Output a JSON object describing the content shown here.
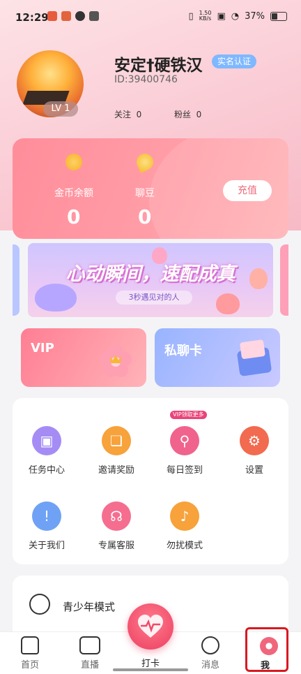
{
  "status_bar": {
    "time": "12:29",
    "net_speed_value": "1.50",
    "net_speed_unit": "KB/s",
    "battery": "37%"
  },
  "profile": {
    "nickname": "安定†硬铁汉",
    "verified_badge": "实名认证",
    "user_id": "ID:39400746",
    "level": "LV 1",
    "follow_label": "关注",
    "follow_count": "0",
    "fans_label": "粉丝",
    "fans_count": "0"
  },
  "wallet": {
    "coins_label": "金币余额",
    "coins_value": "0",
    "beans_label": "聊豆",
    "beans_value": "0",
    "recharge_label": "充值"
  },
  "banner": {
    "title": "心动瞬间，速配成真",
    "subtitle": "3秒遇见对的人"
  },
  "cards": {
    "vip_label": "VIP",
    "private_chat_label": "私聊卡"
  },
  "menu": {
    "vip_tag": "VIP领取更多",
    "items": [
      {
        "label": "任务中心",
        "icon": "task-icon",
        "color": "#a58cf5"
      },
      {
        "label": "邀请奖励",
        "icon": "gift-icon",
        "color": "#f7a23a"
      },
      {
        "label": "每日签到",
        "icon": "location-pin-icon",
        "color": "#f0638d"
      },
      {
        "label": "设置",
        "icon": "gear-icon",
        "color": "#f26a4f"
      },
      {
        "label": "关于我们",
        "icon": "info-icon",
        "color": "#6fa2f5"
      },
      {
        "label": "专属客服",
        "icon": "headset-icon",
        "color": "#f56e8f"
      },
      {
        "label": "勿扰模式",
        "icon": "bell-off-icon",
        "color": "#f7a23a"
      }
    ]
  },
  "youth_mode": {
    "label": "青少年模式"
  },
  "tabbar": {
    "home": "首页",
    "live": "直播",
    "checkin": "打卡",
    "messages": "消息",
    "me": "我"
  }
}
